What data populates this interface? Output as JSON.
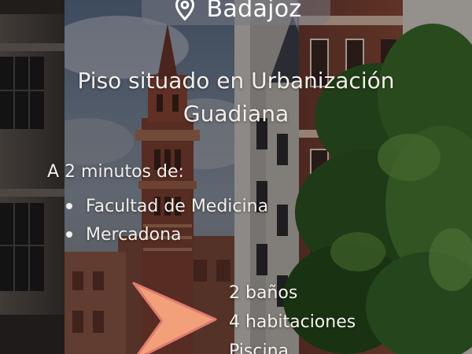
{
  "location": {
    "icon": "map-pin-icon",
    "city": "Badajoz"
  },
  "listing": {
    "headline": "Piso situado en Urbanización Guadiana"
  },
  "nearby": {
    "title": "A 2 minutos de:",
    "items": [
      {
        "label": "Facultad de Medicina"
      },
      {
        "label": "Mercadona"
      }
    ]
  },
  "features": {
    "icon": "chevron-right-icon",
    "accent_color": "#f2a07a",
    "items": [
      {
        "label": "2 baños"
      },
      {
        "label": "4 habitaciones"
      },
      {
        "label": "Piscina"
      }
    ]
  }
}
